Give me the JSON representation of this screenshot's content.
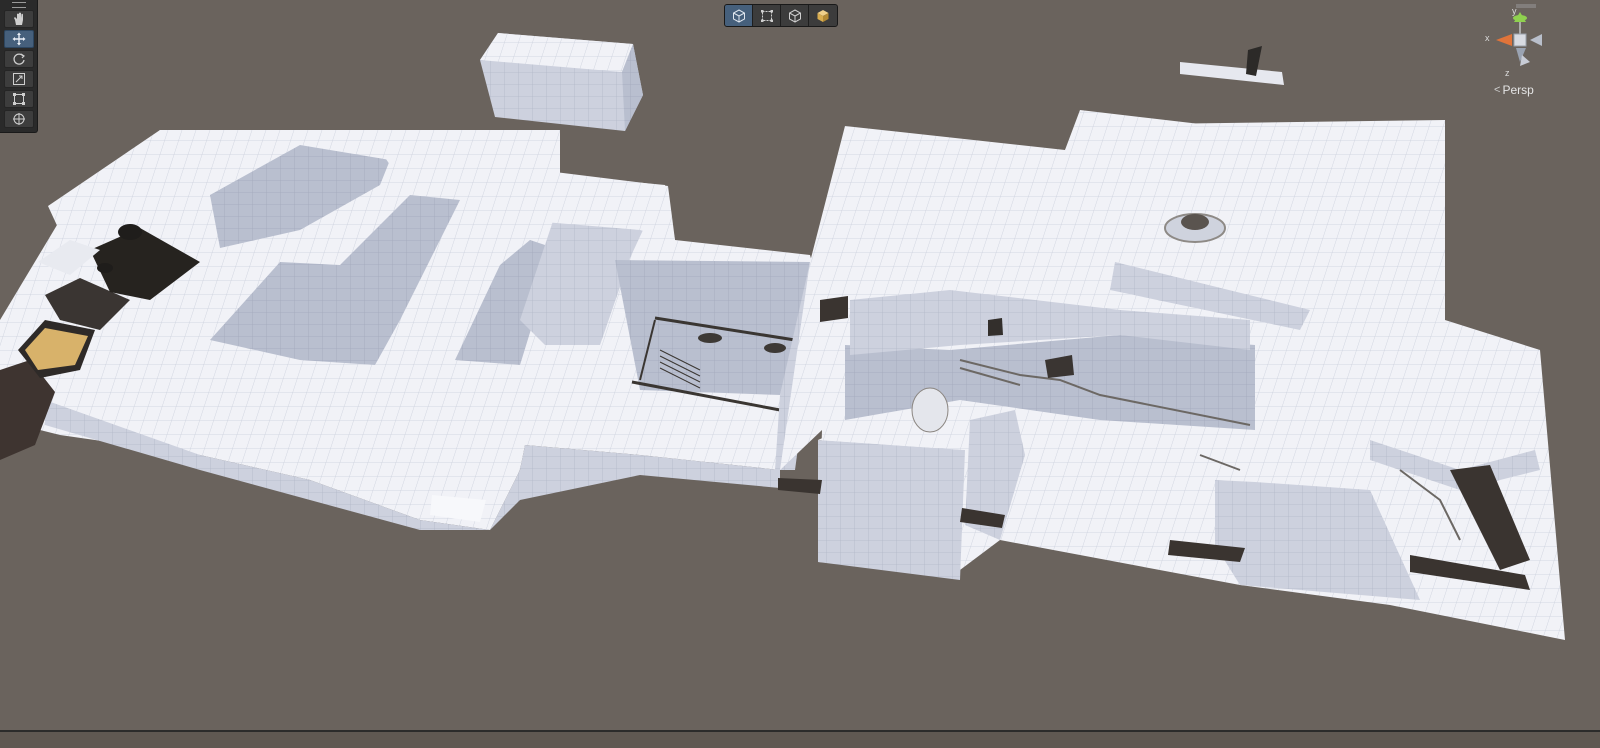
{
  "app": {
    "view": "scene-view"
  },
  "tools": [
    {
      "name": "hand-tool",
      "icon": "hand-icon",
      "active": false
    },
    {
      "name": "move-tool",
      "icon": "move-icon",
      "active": true
    },
    {
      "name": "rotate-tool",
      "icon": "rotate-icon",
      "active": false
    },
    {
      "name": "scale-tool",
      "icon": "scale-icon",
      "active": false
    },
    {
      "name": "rect-tool",
      "icon": "rect-icon",
      "active": false
    },
    {
      "name": "transform-tool",
      "icon": "transform-icon",
      "active": false
    }
  ],
  "view_toolbar": [
    {
      "name": "cube-view-button",
      "icon": "cube-icon",
      "active": true
    },
    {
      "name": "rect-view-button",
      "icon": "rect-icon",
      "active": false
    },
    {
      "name": "wire-cube-button",
      "icon": "wire-cube-icon",
      "active": false
    },
    {
      "name": "shaded-cube-button",
      "icon": "shaded-cube-icon",
      "active": false
    }
  ],
  "gizmo": {
    "projection_label": "Persp",
    "axis_y": "y",
    "axis_x": "x",
    "axis_z": "z"
  },
  "colors": {
    "background": "#6a635d",
    "geometry_top": "#f3f4f8",
    "geometry_side": "#c5cad6",
    "accent_blue": "#46607c",
    "axis_y": "#8fd14f",
    "axis_x": "#e0743a",
    "axis_z": "#5b8bd8"
  }
}
